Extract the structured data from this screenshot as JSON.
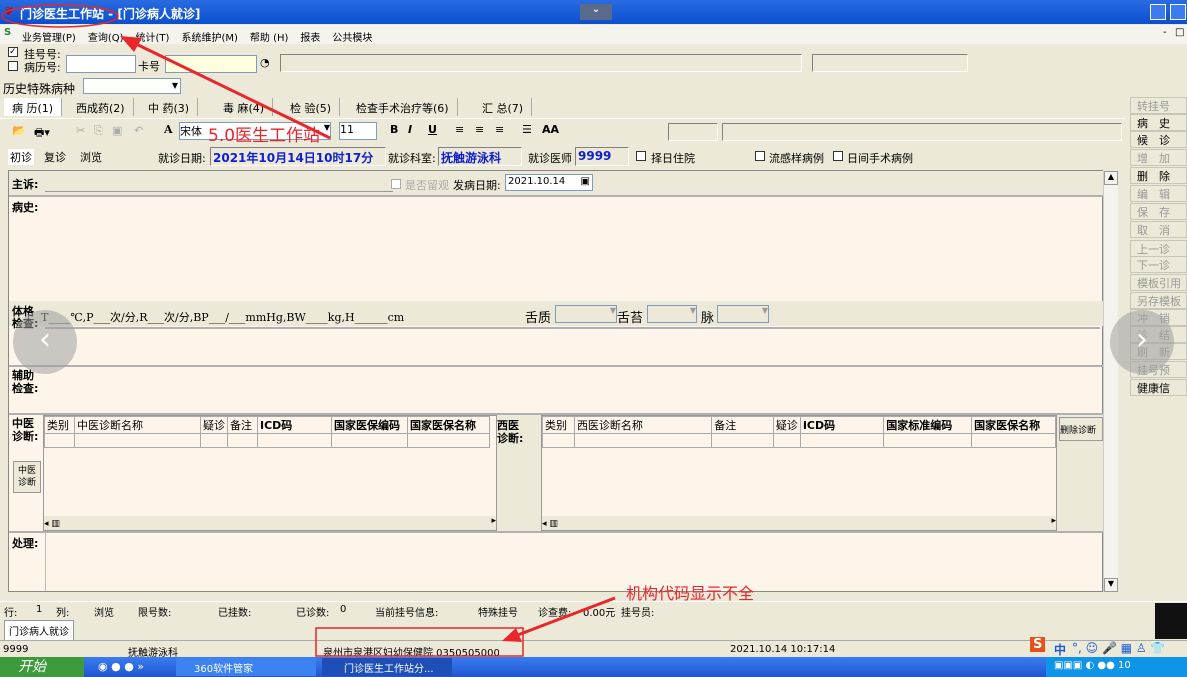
{
  "window": {
    "title": "门诊医生工作站 - [门诊病人就诊]"
  },
  "menu": [
    "业务管理(P)",
    "查询(Q)",
    "统计(T)",
    "系统维护(M)",
    "帮助 (H)",
    "报表",
    "公共模块"
  ],
  "patient": {
    "reg_no_label": "挂号号:",
    "record_no_label": "病历号:",
    "card_label": "卡号",
    "reg_checked": true,
    "record_checked": false,
    "history_label": "历史特殊病种"
  },
  "tabs": [
    "病 历(1)",
    "西成药(2)",
    "中 药(3)",
    "毒 麻(4)",
    "检 验(5)",
    "检查手术治疗等(6)",
    "汇 总(7)"
  ],
  "toolbar": {
    "font": "宋体",
    "size": "11"
  },
  "visit": {
    "modes": [
      "初诊",
      "复诊",
      "浏览"
    ],
    "date_label": "就诊日期:",
    "date": "2021年10月14日10时17分",
    "dept_label": "就诊科室:",
    "dept": "抚触游泳科",
    "doctor_label": "就诊医师",
    "doctor": "9999",
    "checks": [
      "择日住院",
      "流感样病例",
      "日间手术病例"
    ]
  },
  "form": {
    "complaint": "主诉:",
    "chronic": "是否留观",
    "onset_label": "发病日期:",
    "onset": "2021.10.14",
    "history": "病史:",
    "exam": "体格检查:",
    "vitals": "T____℃,P___次/分,R___次/分,BP___/___mmHg,BW____kg,H______cm",
    "tongue": "舌质",
    "coating": "舌苔",
    "pulse": "脉",
    "aux": "辅助检查:",
    "tcm": "中医诊断:",
    "tcm_btn": "中医诊断",
    "western": "西医诊断:",
    "treat": "处理:",
    "delete_btn": "删除诊断"
  },
  "tcm_cols": [
    "类别",
    "中医诊断名称",
    "疑诊",
    "备注",
    "ICD码",
    "国家医保编码",
    "国家医保名称"
  ],
  "west_cols": [
    "类别",
    "西医诊断名称",
    "备注",
    "疑诊",
    "ICD码",
    "国家标准编码",
    "国家医保名称"
  ],
  "right_buttons": [
    {
      "label": "转挂号",
      "on": false
    },
    {
      "label": "病　史",
      "on": true
    },
    {
      "label": "候　诊",
      "on": true
    },
    {
      "label": "增　加",
      "on": false
    },
    {
      "label": "删　除",
      "on": true
    },
    {
      "label": "编　辑",
      "on": false
    },
    {
      "label": "保　存",
      "on": false
    },
    {
      "label": "取　消",
      "on": false
    },
    {
      "label": "上一诊",
      "on": false
    },
    {
      "label": "下一诊",
      "on": false
    },
    {
      "label": "模板引用",
      "on": false
    },
    {
      "label": "另存模板",
      "on": false
    },
    {
      "label": "冲　销",
      "on": false
    },
    {
      "label": "诊　结",
      "on": false
    },
    {
      "label": "刷　新",
      "on": false
    },
    {
      "label": "挂号预",
      "on": false
    },
    {
      "label": "健康信",
      "on": true
    }
  ],
  "status": {
    "row": "行:",
    "row_v": "1",
    "col": "列:",
    "mode": "浏览",
    "limit": "限号数:",
    "registered": "已挂数:",
    "seen": "已诊数:",
    "seen_v": "0",
    "cur": "当前挂号信息:",
    "special": "特殊挂号",
    "fee": "诊查费:",
    "fee_v": "0.00元",
    "reg_staff": "挂号员:"
  },
  "doc_tab": "门诊病人就诊",
  "footer": {
    "user": "9999",
    "dept": "抚触游泳科",
    "org": "泉州市泉港区妇幼保健院 0350505000",
    "time": "2021.10.14 10:17:14"
  },
  "taskbar": {
    "start": "开始",
    "items": [
      "360软件管家",
      "门诊医生工作站分..."
    ],
    "ime": "中"
  },
  "annotations": {
    "note1": "5.0医生工作站",
    "note2": "机构代码显示不全",
    "color": "#e8262b"
  }
}
